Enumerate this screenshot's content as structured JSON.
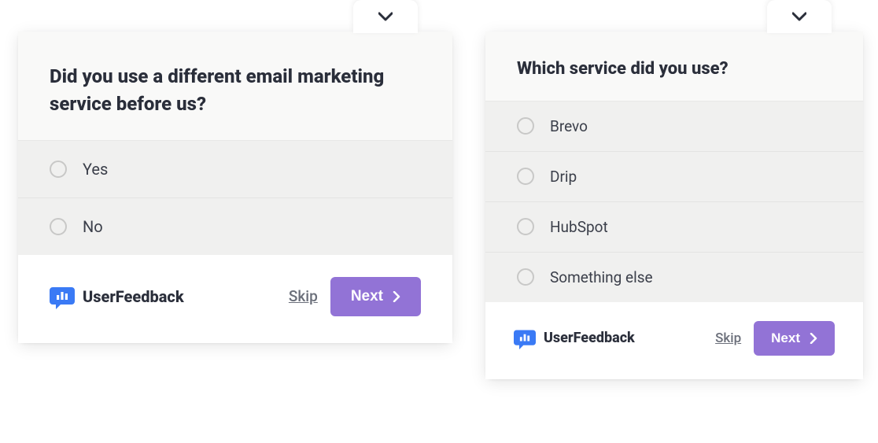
{
  "survey1": {
    "question": "Did you use a different email marketing service before us?",
    "options": [
      "Yes",
      "No"
    ],
    "brand": "UserFeedback",
    "skip_label": "Skip",
    "next_label": "Next"
  },
  "survey2": {
    "question": "Which service did you use?",
    "options": [
      "Brevo",
      "Drip",
      "HubSpot",
      "Something else"
    ],
    "brand": "UserFeedback",
    "skip_label": "Skip",
    "next_label": "Next"
  },
  "colors": {
    "accent": "#9273d6",
    "brand_icon": "#3a7af5"
  }
}
